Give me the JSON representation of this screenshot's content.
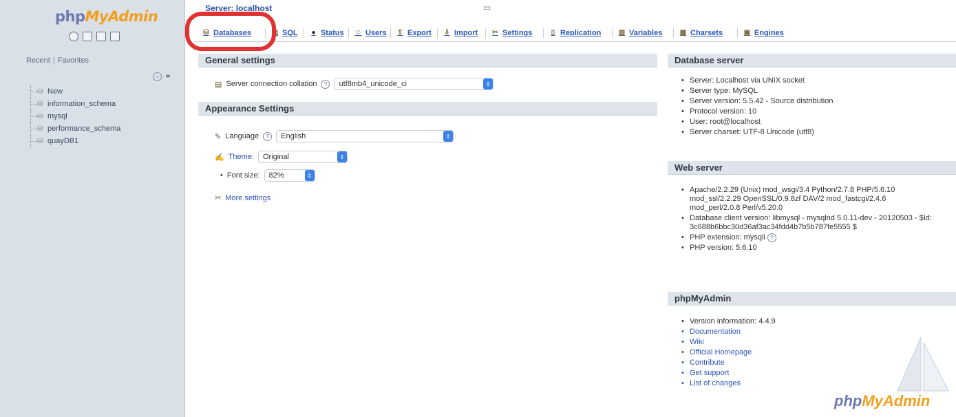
{
  "sidebar": {
    "logo": {
      "php": "php",
      "my": "My",
      "admin": "Admin"
    },
    "icons": [
      "home-icon",
      "sql-window-icon",
      "docs-icon",
      "settings-icon"
    ],
    "recent_label": "Recent",
    "favorites_label": "Favorites",
    "tree": [
      {
        "label": "New",
        "icon": "new-db-icon"
      },
      {
        "label": "information_schema",
        "icon": "database-icon"
      },
      {
        "label": "mysql",
        "icon": "database-icon"
      },
      {
        "label": "performance_schema",
        "icon": "database-icon"
      },
      {
        "label": "quayDB1",
        "icon": "database-icon"
      }
    ]
  },
  "breadcrumb": {
    "server": "Server: localhost"
  },
  "tabs": [
    {
      "label": "Databases",
      "icon": "databases-icon"
    },
    {
      "label": "SQL",
      "icon": "sql-icon"
    },
    {
      "label": "Status",
      "icon": "status-icon"
    },
    {
      "label": "Users",
      "icon": "users-icon"
    },
    {
      "label": "Export",
      "icon": "export-icon"
    },
    {
      "label": "Import",
      "icon": "import-icon"
    },
    {
      "label": "Settings",
      "icon": "settings-icon"
    },
    {
      "label": "Replication",
      "icon": "replication-icon"
    },
    {
      "label": "Variables",
      "icon": "variables-icon"
    },
    {
      "label": "Charsets",
      "icon": "charsets-icon"
    },
    {
      "label": "Engines",
      "icon": "engines-icon"
    }
  ],
  "general": {
    "title": "General settings",
    "collation_label": "Server connection collation",
    "collation_value": "utf8mb4_unicode_ci"
  },
  "appearance": {
    "title": "Appearance Settings",
    "language_label": "Language",
    "language_value": "English",
    "theme_label": "Theme:",
    "theme_value": "Original",
    "fontsize_label": "Font size:",
    "fontsize_value": "82%",
    "more_settings": "More settings"
  },
  "db_server": {
    "title": "Database server",
    "items": [
      "Server: Localhost via UNIX socket",
      "Server type: MySQL",
      "Server version: 5.5.42 - Source distribution",
      "Protocol version: 10",
      "User: root@localhost",
      "Server charset: UTF-8 Unicode (utf8)"
    ]
  },
  "web_server": {
    "title": "Web server",
    "items": [
      "Apache/2.2.29 (Unix) mod_wsgi/3.4 Python/2.7.8 PHP/5.6.10 mod_ssl/2.2.29 OpenSSL/0.9.8zf DAV/2 mod_fastcgi/2.4.6 mod_perl/2.0.8 Perl/v5.20.0",
      "Database client version: libmysql - mysqlnd 5.0.11-dev - 20120503 - $Id: 3c688b6bbc30d36af3ac34fdd4b7b5b787fe5555 $",
      "PHP extension: mysqli",
      "PHP version: 5.6.10"
    ]
  },
  "pma": {
    "title": "phpMyAdmin",
    "version": "Version information: 4.4.9",
    "links": [
      "Documentation",
      "Wiki",
      "Official Homepage",
      "Contribute",
      "Get support",
      "List of changes"
    ],
    "watermark_php": "php",
    "watermark_rest": "MyAdmin"
  },
  "colors": {
    "accent": "#2b55b8",
    "highlight": "#e03232",
    "logo_orange": "#f29f1d",
    "logo_blue": "#6c78af"
  }
}
